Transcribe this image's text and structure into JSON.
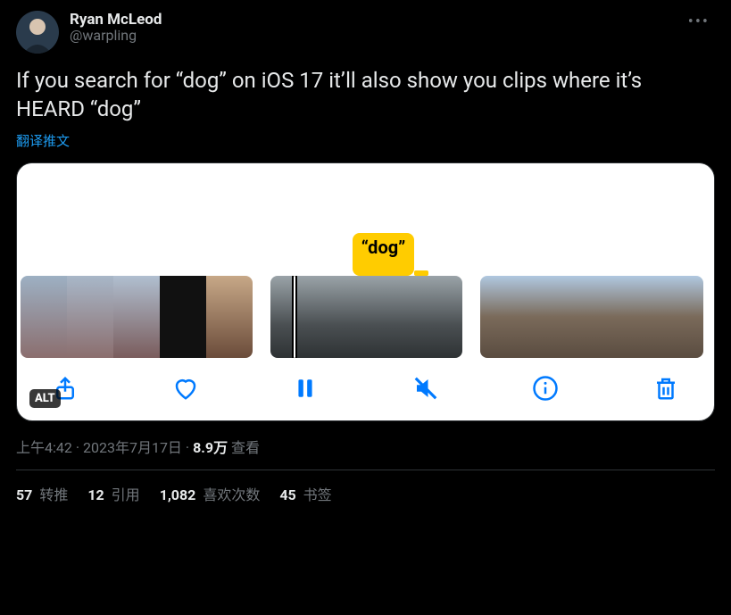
{
  "author": {
    "display_name": "Ryan McLeod",
    "handle": "@warpling"
  },
  "body": "If you search for “dog” on iOS 17 it’ll also show you clips where it’s HEARD “dog”",
  "translate_label": "翻译推文",
  "media": {
    "tooltip": "“dog”",
    "alt_badge": "ALT"
  },
  "meta": {
    "time": "上午4:42",
    "sep1": " · ",
    "date": "2023年7月17日",
    "sep2": " · ",
    "views_count": "8.9万",
    "views_label": " 查看"
  },
  "stats": {
    "retweets": {
      "count": "57",
      "label": " 转推"
    },
    "quotes": {
      "count": "12",
      "label": " 引用"
    },
    "likes": {
      "count": "1,082",
      "label": " 喜欢次数"
    },
    "bookmarks": {
      "count": "45",
      "label": " 书签"
    }
  }
}
